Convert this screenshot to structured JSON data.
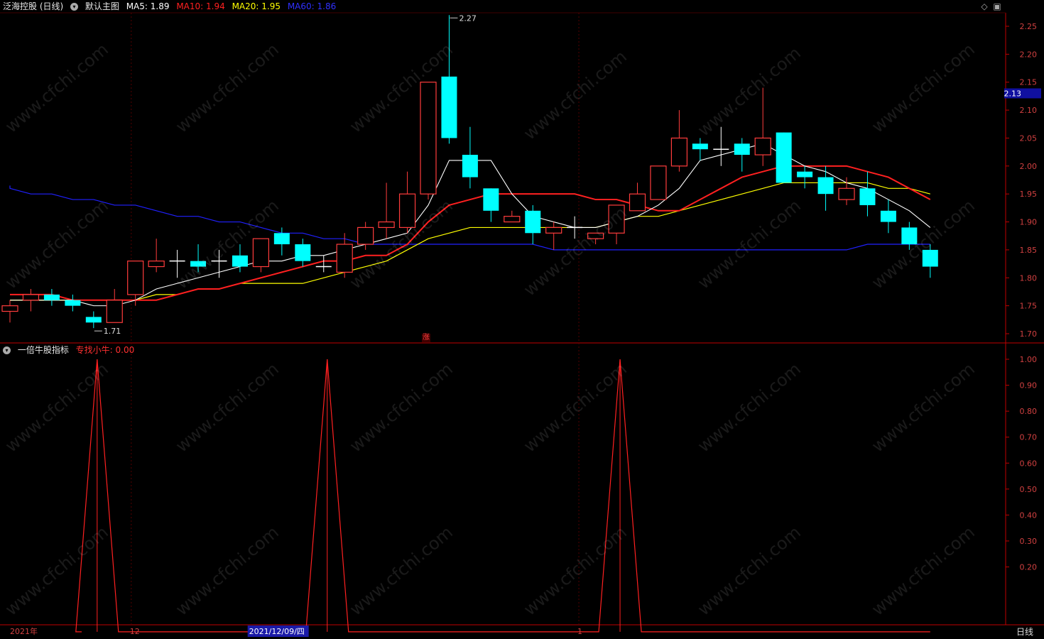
{
  "header": {
    "stock": "泛海控股 (日线)",
    "template": "默认主图",
    "ma5_label": "MA5:",
    "ma5_value": "1.89",
    "ma10_label": "MA10:",
    "ma10_value": "1.94",
    "ma20_label": "MA20:",
    "ma20_value": "1.95",
    "ma60_label": "MA60:",
    "ma60_value": "1.86"
  },
  "indicator_header": {
    "name": "一倍牛股指标",
    "line_label": "专找小牛:",
    "line_value": "0.00"
  },
  "bottom_bar": {
    "period_button": "日线"
  },
  "zhang_marker": "涨",
  "watermark": "www.cfchi.com",
  "colors": {
    "up": "#ff3c3c",
    "down": "#00ffff",
    "ma5": "#ffffff",
    "ma10": "#ff2020",
    "ma20": "#ffff00",
    "ma60": "#2020ff",
    "axis": "#c00000",
    "background": "#000000"
  },
  "chart_data": [
    {
      "type": "candlestick",
      "y_ticks": [
        "2.25",
        "2.20",
        "2.15",
        "2.10",
        "2.05",
        "2.00",
        "1.95",
        "1.90",
        "1.85",
        "1.80",
        "1.75",
        "1.70"
      ],
      "ylim": [
        1.68,
        2.29
      ],
      "current_price": "2.13",
      "annotations": [
        {
          "text": "2.27",
          "index": 21
        },
        {
          "text": "1.71",
          "index": 4
        }
      ],
      "candles": [
        {
          "o": 1.74,
          "c": 1.75,
          "h": 1.76,
          "l": 1.72
        },
        {
          "o": 1.76,
          "c": 1.77,
          "h": 1.78,
          "l": 1.74
        },
        {
          "o": 1.77,
          "c": 1.76,
          "h": 1.78,
          "l": 1.75
        },
        {
          "o": 1.76,
          "c": 1.75,
          "h": 1.77,
          "l": 1.74
        },
        {
          "o": 1.73,
          "c": 1.72,
          "h": 1.74,
          "l": 1.71
        },
        {
          "o": 1.72,
          "c": 1.76,
          "h": 1.78,
          "l": 1.72
        },
        {
          "o": 1.77,
          "c": 1.83,
          "h": 1.83,
          "l": 1.75
        },
        {
          "o": 1.82,
          "c": 1.83,
          "h": 1.87,
          "l": 1.81
        },
        {
          "o": 1.83,
          "c": 1.83,
          "h": 1.85,
          "l": 1.8
        },
        {
          "o": 1.83,
          "c": 1.82,
          "h": 1.86,
          "l": 1.81
        },
        {
          "o": 1.83,
          "c": 1.83,
          "h": 1.85,
          "l": 1.8
        },
        {
          "o": 1.84,
          "c": 1.82,
          "h": 1.86,
          "l": 1.81
        },
        {
          "o": 1.82,
          "c": 1.87,
          "h": 1.87,
          "l": 1.81
        },
        {
          "o": 1.88,
          "c": 1.86,
          "h": 1.89,
          "l": 1.84
        },
        {
          "o": 1.86,
          "c": 1.83,
          "h": 1.87,
          "l": 1.82
        },
        {
          "o": 1.82,
          "c": 1.82,
          "h": 1.84,
          "l": 1.81
        },
        {
          "o": 1.81,
          "c": 1.86,
          "h": 1.88,
          "l": 1.8
        },
        {
          "o": 1.86,
          "c": 1.89,
          "h": 1.9,
          "l": 1.85
        },
        {
          "o": 1.89,
          "c": 1.9,
          "h": 1.97,
          "l": 1.87
        },
        {
          "o": 1.89,
          "c": 1.95,
          "h": 1.99,
          "l": 1.88
        },
        {
          "o": 1.95,
          "c": 2.15,
          "h": 2.15,
          "l": 1.94
        },
        {
          "o": 2.16,
          "c": 2.05,
          "h": 2.27,
          "l": 2.04
        },
        {
          "o": 2.02,
          "c": 1.98,
          "h": 2.07,
          "l": 1.96
        },
        {
          "o": 1.96,
          "c": 1.92,
          "h": 1.96,
          "l": 1.9
        },
        {
          "o": 1.9,
          "c": 1.91,
          "h": 1.92,
          "l": 1.9
        },
        {
          "o": 1.92,
          "c": 1.88,
          "h": 1.93,
          "l": 1.86
        },
        {
          "o": 1.88,
          "c": 1.89,
          "h": 1.9,
          "l": 1.85
        },
        {
          "o": 1.89,
          "c": 1.89,
          "h": 1.91,
          "l": 1.87
        },
        {
          "o": 1.87,
          "c": 1.88,
          "h": 1.88,
          "l": 1.86
        },
        {
          "o": 1.88,
          "c": 1.93,
          "h": 1.93,
          "l": 1.86
        },
        {
          "o": 1.92,
          "c": 1.95,
          "h": 1.97,
          "l": 1.92
        },
        {
          "o": 1.94,
          "c": 2.0,
          "h": 2.0,
          "l": 1.94
        },
        {
          "o": 2.0,
          "c": 2.05,
          "h": 2.1,
          "l": 1.99
        },
        {
          "o": 2.04,
          "c": 2.03,
          "h": 2.05,
          "l": 2.01
        },
        {
          "o": 2.03,
          "c": 2.03,
          "h": 2.07,
          "l": 2.0
        },
        {
          "o": 2.04,
          "c": 2.02,
          "h": 2.05,
          "l": 1.99
        },
        {
          "o": 2.02,
          "c": 2.05,
          "h": 2.14,
          "l": 2.0
        },
        {
          "o": 2.06,
          "c": 1.97,
          "h": 2.06,
          "l": 1.97
        },
        {
          "o": 1.99,
          "c": 1.98,
          "h": 2.0,
          "l": 1.96
        },
        {
          "o": 1.98,
          "c": 1.95,
          "h": 2.0,
          "l": 1.92
        },
        {
          "o": 1.94,
          "c": 1.96,
          "h": 1.98,
          "l": 1.93
        },
        {
          "o": 1.96,
          "c": 1.93,
          "h": 1.99,
          "l": 1.91
        },
        {
          "o": 1.92,
          "c": 1.9,
          "h": 1.94,
          "l": 1.88
        },
        {
          "o": 1.89,
          "c": 1.86,
          "h": 1.9,
          "l": 1.85
        },
        {
          "o": 1.85,
          "c": 1.82,
          "h": 1.86,
          "l": 1.8
        }
      ],
      "series": [
        {
          "name": "MA5",
          "values": [
            1.76,
            1.76,
            1.76,
            1.76,
            1.75,
            1.75,
            1.76,
            1.78,
            1.79,
            1.8,
            1.81,
            1.82,
            1.83,
            1.83,
            1.84,
            1.84,
            1.85,
            1.86,
            1.87,
            1.88,
            1.93,
            2.01,
            2.01,
            2.01,
            1.95,
            1.91,
            1.9,
            1.89,
            1.89,
            1.9,
            1.91,
            1.93,
            1.96,
            2.01,
            2.02,
            2.03,
            2.04,
            2.02,
            2.0,
            1.99,
            1.97,
            1.96,
            1.94,
            1.92,
            1.89
          ]
        },
        {
          "name": "MA10",
          "values": [
            1.77,
            1.77,
            1.77,
            1.76,
            1.76,
            1.76,
            1.76,
            1.76,
            1.77,
            1.78,
            1.78,
            1.79,
            1.8,
            1.81,
            1.82,
            1.83,
            1.83,
            1.84,
            1.84,
            1.86,
            1.9,
            1.93,
            1.94,
            1.95,
            1.95,
            1.95,
            1.95,
            1.95,
            1.94,
            1.94,
            1.93,
            1.92,
            1.92,
            1.94,
            1.96,
            1.98,
            1.99,
            2.0,
            2.0,
            2.0,
            2.0,
            1.99,
            1.98,
            1.96,
            1.94
          ]
        },
        {
          "name": "MA20",
          "values": [
            1.76,
            1.76,
            1.76,
            1.76,
            1.76,
            1.76,
            1.76,
            1.77,
            1.77,
            1.78,
            1.78,
            1.79,
            1.79,
            1.79,
            1.79,
            1.8,
            1.81,
            1.82,
            1.83,
            1.85,
            1.87,
            1.88,
            1.89,
            1.89,
            1.89,
            1.89,
            1.89,
            1.89,
            1.89,
            1.9,
            1.91,
            1.91,
            1.92,
            1.93,
            1.94,
            1.95,
            1.96,
            1.97,
            1.97,
            1.97,
            1.97,
            1.97,
            1.96,
            1.96,
            1.95
          ]
        },
        {
          "name": "MA60",
          "values": [
            1.96,
            1.95,
            1.95,
            1.94,
            1.94,
            1.93,
            1.93,
            1.92,
            1.91,
            1.91,
            1.9,
            1.9,
            1.89,
            1.88,
            1.88,
            1.87,
            1.87,
            1.86,
            1.86,
            1.86,
            1.86,
            1.86,
            1.86,
            1.86,
            1.86,
            1.86,
            1.85,
            1.85,
            1.85,
            1.85,
            1.85,
            1.85,
            1.85,
            1.85,
            1.85,
            1.85,
            1.85,
            1.85,
            1.85,
            1.85,
            1.85,
            1.86,
            1.86,
            1.86,
            1.86
          ]
        }
      ],
      "ma60_extra_left": 1.965
    },
    {
      "type": "line",
      "y_ticks": [
        "1.00",
        "0.90",
        "0.80",
        "0.70",
        "0.60",
        "0.50",
        "0.40",
        "0.30",
        "0.20"
      ],
      "ylim": [
        -0.05,
        1.0
      ],
      "series": [
        {
          "name": "专找小牛",
          "values": [
            0,
            0,
            0,
            0,
            1,
            0,
            0,
            0,
            0,
            0,
            0,
            0,
            0,
            0,
            0,
            1,
            0,
            0,
            0,
            0,
            0,
            0,
            0,
            0,
            0,
            0,
            0,
            0,
            0,
            1,
            0,
            0,
            0,
            0,
            0,
            0,
            0,
            0,
            0,
            0,
            0,
            0,
            0,
            0,
            0
          ]
        }
      ]
    }
  ],
  "x_axis": {
    "labels": [
      {
        "text": "2021年",
        "index": 0
      },
      {
        "text": "12",
        "index": 5.8
      },
      {
        "text": "2021/12/09/四",
        "index": 11.5,
        "highlight": true
      },
      {
        "text": "1",
        "index": 27.2
      }
    ]
  }
}
